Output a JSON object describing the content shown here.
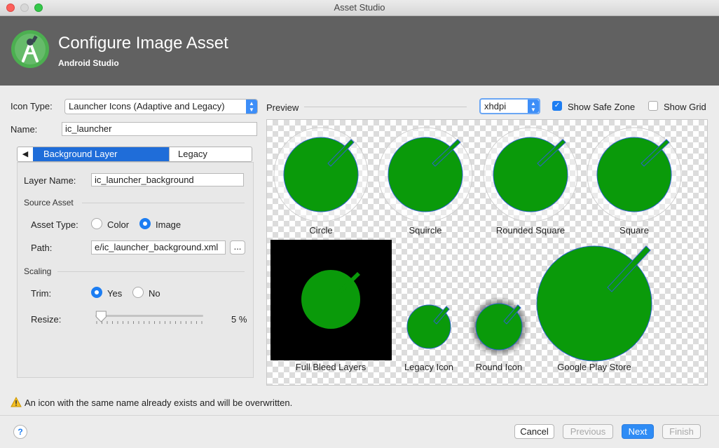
{
  "window": {
    "title": "Asset Studio"
  },
  "header": {
    "title": "Configure Image Asset",
    "subtitle": "Android Studio"
  },
  "form": {
    "icon_type_label": "Icon Type:",
    "icon_type_value": "Launcher Icons (Adaptive and Legacy)",
    "name_label": "Name:",
    "name_value": "ic_launcher"
  },
  "tabs": {
    "active": "Background Layer",
    "inactive": "Legacy"
  },
  "layer": {
    "layer_name_label": "Layer Name:",
    "layer_name_value": "ic_launcher_background",
    "source_asset_section": "Source Asset",
    "asset_type_label": "Asset Type:",
    "asset_type_options": [
      "Color",
      "Image"
    ],
    "asset_type_selected": "Image",
    "path_label": "Path:",
    "path_value": "e/ic_launcher_background.xml",
    "browse_label": "...",
    "scaling_section": "Scaling",
    "trim_label": "Trim:",
    "trim_options": [
      "Yes",
      "No"
    ],
    "trim_selected": "Yes",
    "resize_label": "Resize:",
    "resize_value": "5 %",
    "resize_level": 0.05
  },
  "preview": {
    "label": "Preview",
    "density": "xhdpi",
    "show_safe_zone_label": "Show Safe Zone",
    "show_safe_zone": true,
    "show_grid_label": "Show Grid",
    "show_grid": false,
    "icons": [
      "Circle",
      "Squircle",
      "Rounded Square",
      "Square",
      "Full Bleed Layers",
      "Legacy Icon",
      "Round Icon",
      "Google Play Store"
    ],
    "icon_color": "#0a9a0a"
  },
  "warning": {
    "text": "An icon with the same name already exists and will be overwritten."
  },
  "footer": {
    "help": "?",
    "cancel": "Cancel",
    "previous": "Previous",
    "next": "Next",
    "finish": "Finish"
  }
}
